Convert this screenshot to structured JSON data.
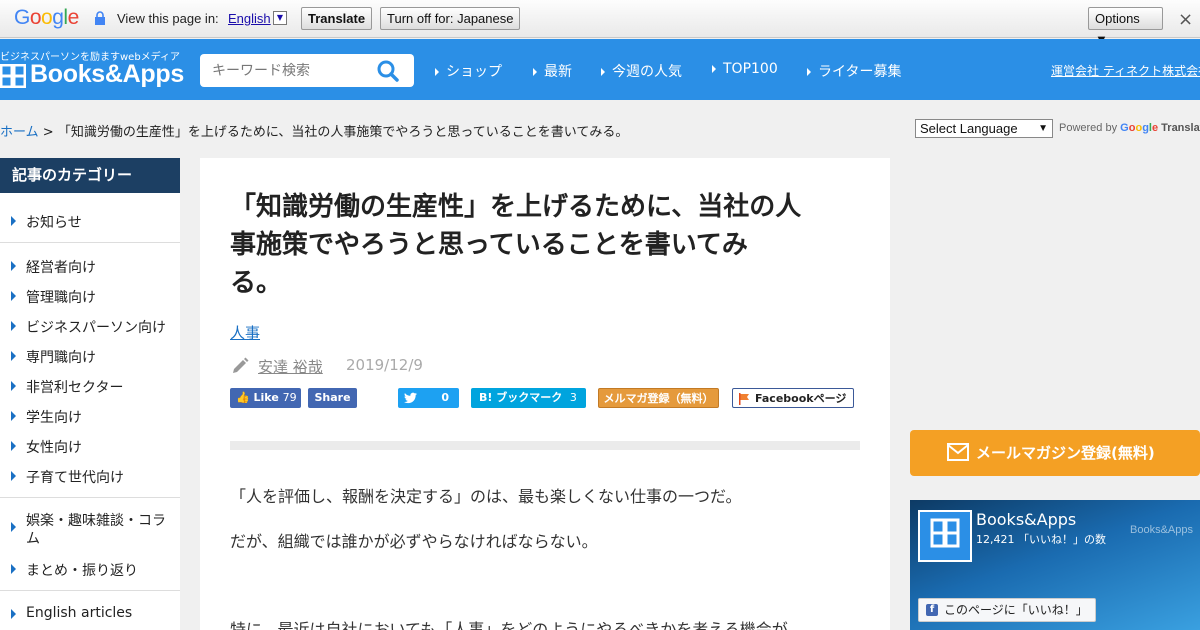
{
  "google_bar": {
    "logo": [
      "G",
      "o",
      "o",
      "g",
      "l",
      "e"
    ],
    "view_label": "View this page in:",
    "language": "English",
    "translate_btn": "Translate",
    "turn_off_btn": "Turn off for: Japanese",
    "options_btn": "Options ▼",
    "close": "×"
  },
  "header": {
    "tagline": "ビジネスパーソンを励ますwebメディア",
    "logo": "Books&Apps",
    "search_placeholder": "キーワード検索",
    "nav": [
      "ショップ",
      "最新",
      "今週の人気",
      "TOP100",
      "ライター募集"
    ],
    "company": "運営会社 ティネクト株式会社"
  },
  "breadcrumb": {
    "home": "ホーム",
    "separator": ">",
    "current": "「知識労働の生産性」を上げるために、当社の人事施策でやろうと思っていることを書いてみる。"
  },
  "translate_widget": {
    "select_label": "Select Language",
    "arrow": "▼",
    "powered_by": "Powered by",
    "google": [
      "G",
      "o",
      "o",
      "g",
      "l",
      "e"
    ],
    "translate": "Translate"
  },
  "sidebar": {
    "title": "記事のカテゴリー",
    "items": [
      "お知らせ",
      "経営者向け",
      "管理職向け",
      "ビジネスパーソン向け",
      "専門職向け",
      "非営利セクター",
      "学生向け",
      "女性向け",
      "子育て世代向け",
      "娯楽・趣味雑談・コラム",
      "まとめ・振り返り",
      "English articles"
    ]
  },
  "article": {
    "title_lines": [
      "「知識労働の生産性」を上げるために、当社の人",
      "事施策でやろうと思っていることを書いてみ",
      "る。"
    ],
    "tag": "人事",
    "author": "安達 裕哉",
    "date": "2019/12/9",
    "share": {
      "fb_like": "Like",
      "fb_like_count": "79",
      "fb_share": "Share",
      "tweet_count": "0",
      "hatena": "B! ブックマーク",
      "hatena_count": "3",
      "mailmag": "メルマガ登録（無料）",
      "fb_page": "Facebookページ"
    },
    "paragraphs": [
      "「人を評価し、報酬を決定する」のは、最も楽しくない仕事の一つだ。",
      "だが、組織では誰かが必ずやらなければならない。",
      "特に、最近は自社においても「人事」をどのようにやるべきかを考える機会が"
    ]
  },
  "right": {
    "mailmag_btn": "メールマガジン登録(無料)",
    "fb_widget": {
      "name": "Books&Apps",
      "count": "12,421 「いいね！」の数",
      "watermark": "Books&Apps",
      "like_page": "このページに「いいね！」"
    }
  },
  "colors": {
    "header_blue": "#2b8fe6",
    "sidebar_navy": "#1c3f63",
    "link_blue": "#1a70c4",
    "orange": "#f4a024"
  }
}
